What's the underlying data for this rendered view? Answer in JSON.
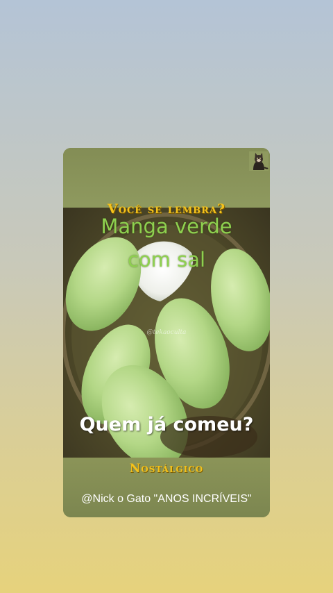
{
  "story": {
    "heading": "Você se lembra?",
    "title_line1": "Manga verde",
    "title_line2": "com sal",
    "watermark": "@tekaoculta",
    "question": "Quem já comeu?",
    "tag": "Nostálgico",
    "credit": "@Nick o Gato \"ANOS INCRÍVEIS\""
  },
  "icons": {
    "avatar": "cat-avatar-icon"
  },
  "colors": {
    "heading_yellow": "#f4c21c",
    "title_green": "#8ed04f",
    "mango_green": "#b9dc8c"
  }
}
